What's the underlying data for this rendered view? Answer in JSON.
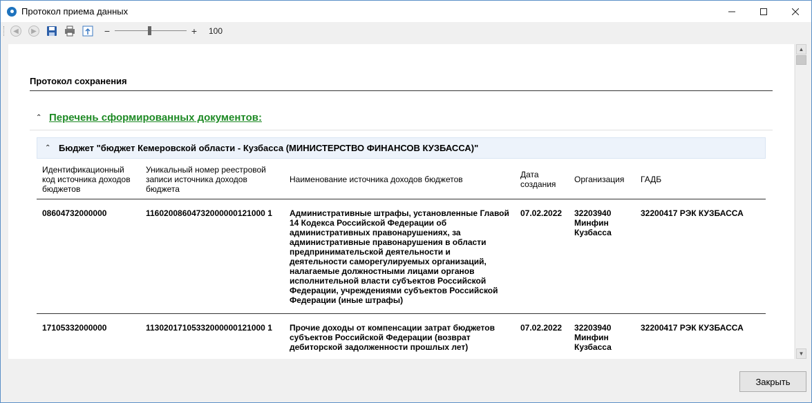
{
  "window": {
    "title": "Протокол приема данных"
  },
  "toolbar": {
    "zoom_value": "100",
    "zoom_level": 100
  },
  "report": {
    "section_title": "Протокол сохранения",
    "list_title": "Перечень сформированных документов:",
    "budget_title": "Бюджет \"бюджет Кемеровской области - Кузбасса (МИНИСТЕРСТВО ФИНАНСОВ КУЗБАССА)\"",
    "columns": [
      "Идентификационный код источника доходов бюджетов",
      "Уникальный номер реестровой записи источника доходов бюджета",
      "Наименование источника доходов бюджетов",
      "Дата создания",
      "Организация",
      "ГАДБ"
    ],
    "rows": [
      {
        "code": "08604732000000",
        "reg_number": "11602008604732000000121000 1",
        "name": "Административные штрафы, установленные Главой 14 Кодекса Российской Федерации об административных правонарушениях, за административные правонарушения в области предпринимательской деятельности и деятельности саморегулируемых организаций, налагаемые должностными лицами органов исполнительной власти субъектов Российской Федерации, учреждениями субъектов Российской Федерации (иные штрафы)",
        "date": "07.02.2022",
        "org": "32203940 Минфин Кузбасса",
        "gadb": "32200417 РЭК КУЗБАССА"
      },
      {
        "code": "17105332000000",
        "reg_number": "11302017105332000000121000 1",
        "name": "Прочие доходы от компенсации затрат бюджетов субъектов Российской Федерации (возврат дебиторской задолженности прошлых лет)",
        "date": "07.02.2022",
        "org": "32203940 Минфин Кузбасса",
        "gadb": "32200417 РЭК КУЗБАССА"
      }
    ]
  },
  "footer": {
    "close_label": "Закрыть"
  }
}
